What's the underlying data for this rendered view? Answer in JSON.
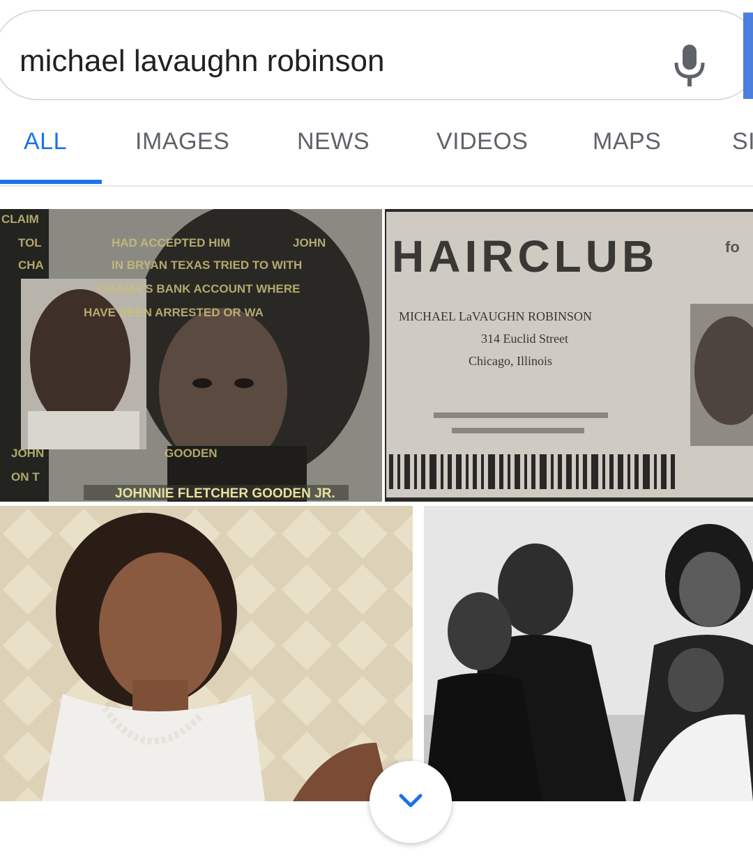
{
  "search": {
    "query": "michael lavaughn robinson"
  },
  "tabs": [
    {
      "label": "ALL",
      "active": true
    },
    {
      "label": "IMAGES",
      "active": false
    },
    {
      "label": "NEWS",
      "active": false
    },
    {
      "label": "VIDEOS",
      "active": false
    },
    {
      "label": "MAPS",
      "active": false
    },
    {
      "label": "SI",
      "active": false
    }
  ],
  "colors": {
    "accent": "#1a73e8",
    "tab_text": "#5f6368",
    "search_edge": "#4a7fe0"
  },
  "images": [
    {
      "overlay_lines": [
        "CLAIM",
        "TOL",
        "CHA",
        "HAD ACCEPTED HIM",
        "JOHN",
        "IN BRYAN TEXAS TRIED TO WITH",
        "OBAMA'S BANK ACCOUNT WHERE",
        "HAVE BEEN ARRESTED OR WA",
        "JOHN",
        "GOODEN",
        "ON T"
      ],
      "caption": "JOHNNIE FLETCHER GOODEN JR."
    },
    {
      "logo": "HAIRCLUB",
      "logo_suffix": "fo",
      "card_name": "MICHAEL LaVAUGHN ROBINSON",
      "card_address": "314 Euclid Street",
      "card_city": "Chicago, Illinois"
    },
    {},
    {}
  ],
  "more_button": {
    "icon": "chevron-down-icon"
  }
}
